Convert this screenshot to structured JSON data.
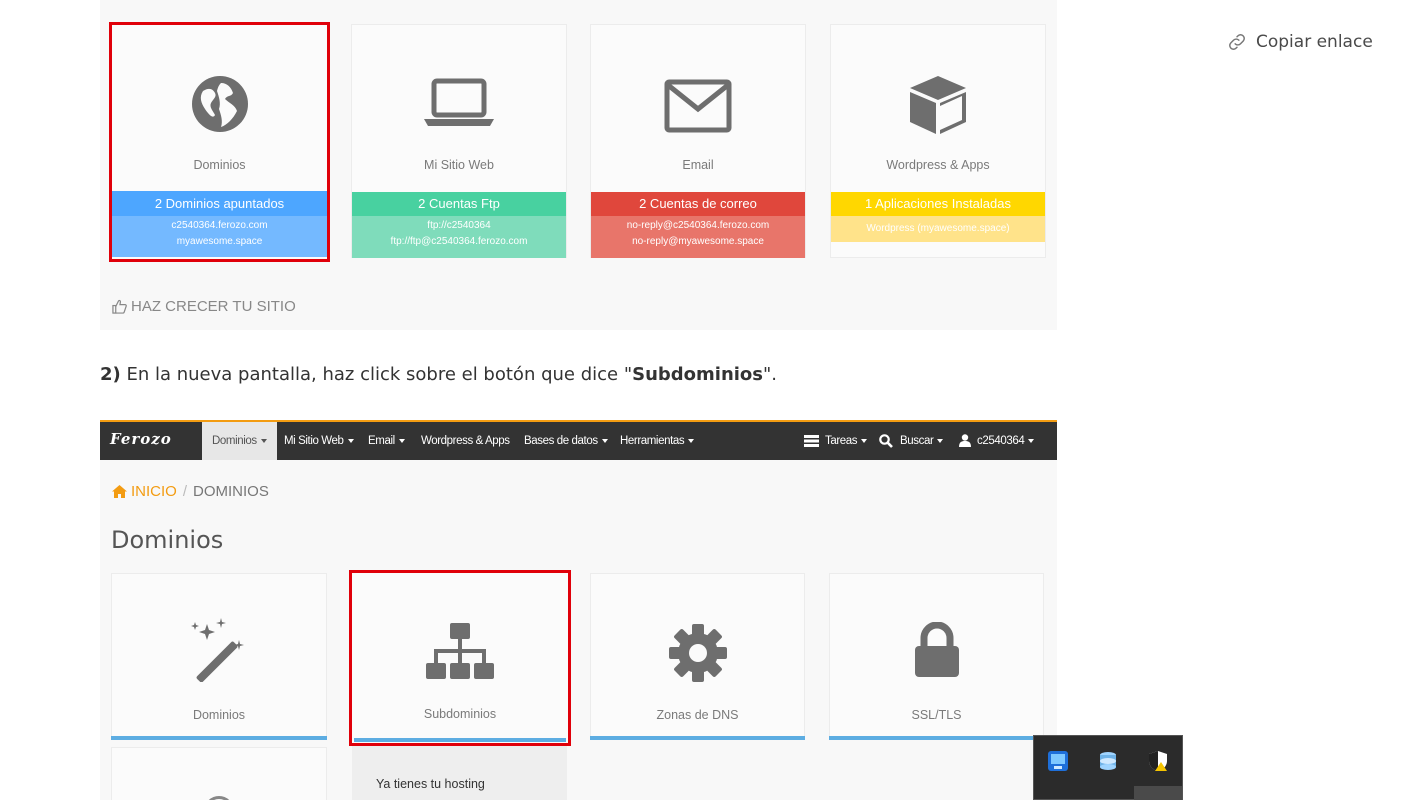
{
  "copy_link": {
    "label": "Copiar enlace",
    "icon": "link-icon"
  },
  "panel1": {
    "cards": [
      {
        "name": "Dominios",
        "bar": "2 Dominios apuntados",
        "details": [
          "c2540364.ferozo.com",
          "myawesome.space"
        ],
        "color": "#4da6ff",
        "sub_color": "#74b9ff",
        "icon": "globe-icon"
      },
      {
        "name": "Mi Sitio Web",
        "bar": "2 Cuentas Ftp",
        "details": [
          "ftp://c2540364",
          "ftp://ftp@c2540364.ferozo.com"
        ],
        "color": "#48d1a0",
        "sub_color": "#7fdcbb",
        "icon": "laptop-icon"
      },
      {
        "name": "Email",
        "bar": "2 Cuentas de correo",
        "details": [
          "no-reply@c2540364.ferozo.com",
          "no-reply@myawesome.space"
        ],
        "color": "#e0473c",
        "sub_color": "#e8756a",
        "icon": "envelope-icon"
      },
      {
        "name": "Wordpress & Apps",
        "bar": "1 Aplicaciones Instaladas",
        "details": [
          "Wordpress (myawesome.space)"
        ],
        "color": "#ffd700",
        "sub_color": "#ffe38a",
        "icon": "cube-icon"
      }
    ],
    "grow_label": "HAZ CRECER TU SITIO"
  },
  "instruction": {
    "number": "2)",
    "text_before": " En la nueva pantalla, haz click sobre el botón que dice \"",
    "bold": "Subdominios",
    "text_after": "\"."
  },
  "panel2": {
    "logo": "Ferozo",
    "nav": [
      "Dominios",
      "Mi Sitio Web",
      "Email",
      "Wordpress & Apps",
      "Bases de datos",
      "Herramientas"
    ],
    "nav_right": [
      "Tareas",
      "Buscar",
      "c2540364"
    ],
    "breadcrumb": {
      "home": "INICIO",
      "sep": "/",
      "current": "DOMINIOS"
    },
    "title": "Dominios",
    "cards": [
      {
        "name": "Dominios",
        "icon": "magic-wand-icon"
      },
      {
        "name": "Subdominios",
        "icon": "sitemap-icon"
      },
      {
        "name": "Zonas de DNS",
        "icon": "gear-icon"
      },
      {
        "name": "SSL/TLS",
        "icon": "lock-icon"
      }
    ],
    "hosting_text": "Ya tienes tu hosting"
  },
  "colors": {
    "accent_red": "#e0000a",
    "nav_bg": "#333333",
    "nav_border": "#f39c12",
    "card_underline": "#5dade2"
  }
}
